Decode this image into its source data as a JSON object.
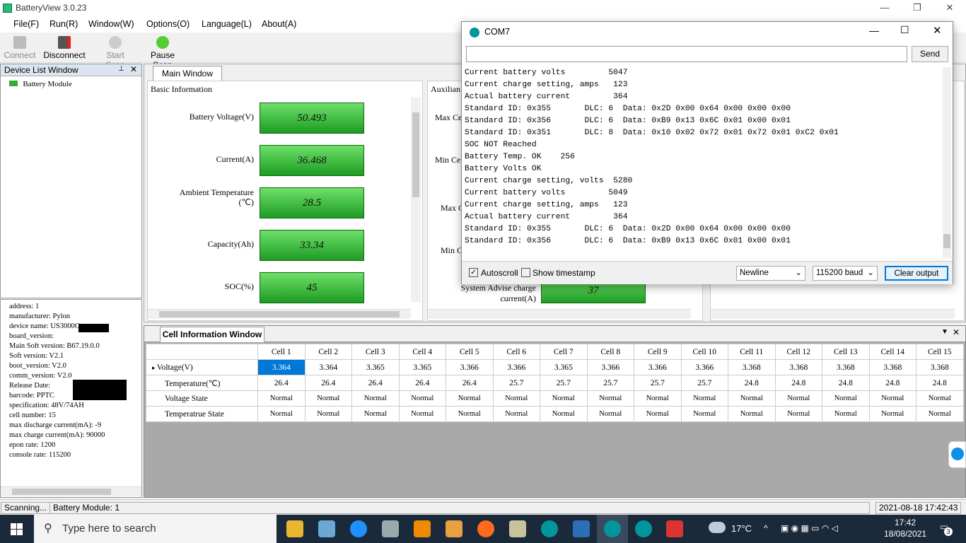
{
  "app": {
    "title": "BatteryView 3.0.23"
  },
  "window_controls": {
    "minimize": "—",
    "maximize": "❐",
    "close": "✕"
  },
  "menu": [
    "File(F)",
    "Run(R)",
    "Window(W)",
    "Options(O)",
    "Language(L)",
    "About(A)"
  ],
  "toolbar": [
    {
      "label": "Connect",
      "icon": "connect-icon"
    },
    {
      "label": "Disconnect",
      "icon": "disconnect-icon"
    },
    {
      "label": "Start Scan",
      "icon": "play-icon"
    },
    {
      "label": "Pause Scan",
      "icon": "pause-icon"
    }
  ],
  "device_list": {
    "title": "Device List Window",
    "item": "Battery Module",
    "pin": "📌",
    "close": "✕"
  },
  "properties": [
    "address: 1",
    "manufacturer: Pylon",
    "device name: US3000C",
    "board_version:",
    "Main Soft version: B67.19.0.0",
    "Soft version: V2.1",
    "boot_version: V2.0",
    "comm_version: V2.0",
    "Release Date:",
    "barcode: PPTC",
    "specification: 48V/74AH",
    "cell number: 15",
    "max discharge current(mA): -9",
    "max charge current(mA): 90000",
    "epon rate: 1200",
    "console rate: 115200"
  ],
  "main": {
    "tab": "Main Window",
    "basic_title": "Basic Information",
    "aux_title": "Auxilian",
    "values": [
      {
        "label": "Battery Voltage(V)",
        "value": "50.493"
      },
      {
        "label": "Current(A)",
        "value": "36.468"
      },
      {
        "label": "Ambient Temperature",
        "label2": "(℃)",
        "value": "28.5"
      },
      {
        "label": "Capacity(Ah)",
        "value": "33.34"
      },
      {
        "label": "SOC(%)",
        "value": "45"
      }
    ],
    "aux_labels": [
      "Max Ce",
      "Min Ce",
      "Max C",
      "Min C"
    ],
    "advise_label": "System Advise charge",
    "advise_label2": "current(A)",
    "advise_value": "37"
  },
  "cell": {
    "tab": "Cell Information Window",
    "headers": [
      "Cell 1",
      "Cell 2",
      "Cell 3",
      "Cell 4",
      "Cell 5",
      "Cell 6",
      "Cell 7",
      "Cell 8",
      "Cell 9",
      "Cell 10",
      "Cell 11",
      "Cell 12",
      "Cell 13",
      "Cell 14",
      "Cell 15"
    ],
    "rows": [
      {
        "name": "Voltage(V)",
        "values": [
          "3.364",
          "3.364",
          "3.365",
          "3.365",
          "3.366",
          "3.366",
          "3.365",
          "3.366",
          "3.366",
          "3.366",
          "3.368",
          "3.368",
          "3.368",
          "3.368",
          "3.368"
        ]
      },
      {
        "name": "Temperature(℃)",
        "values": [
          "26.4",
          "26.4",
          "26.4",
          "26.4",
          "26.4",
          "25.7",
          "25.7",
          "25.7",
          "25.7",
          "25.7",
          "24.8",
          "24.8",
          "24.8",
          "24.8",
          "24.8"
        ]
      },
      {
        "name": "Voltage State",
        "values": [
          "Normal",
          "Normal",
          "Normal",
          "Normal",
          "Normal",
          "Normal",
          "Normal",
          "Normal",
          "Normal",
          "Normal",
          "Normal",
          "Normal",
          "Normal",
          "Normal",
          "Normal"
        ]
      },
      {
        "name": "Temperatrue State",
        "values": [
          "Normal",
          "Normal",
          "Normal",
          "Normal",
          "Normal",
          "Normal",
          "Normal",
          "Normal",
          "Normal",
          "Normal",
          "Normal",
          "Normal",
          "Normal",
          "Normal",
          "Normal"
        ]
      }
    ]
  },
  "status": {
    "scan": "Scanning...",
    "module": "Battery Module: 1",
    "datetime": "2021-08-18 17:42:43"
  },
  "com": {
    "title": "COM7",
    "send": "Send",
    "input": "",
    "lines": [
      "Current battery volts         5047",
      "Current charge setting, amps   123",
      "Actual battery current         364",
      "Standard ID: 0x355       DLC: 6  Data: 0x2D 0x00 0x64 0x00 0x00 0x00",
      "Standard ID: 0x356       DLC: 6  Data: 0xB9 0x13 0x6C 0x01 0x00 0x01",
      "Standard ID: 0x351       DLC: 8  Data: 0x10 0x02 0x72 0x01 0x72 0x01 0xC2 0x01",
      "SOC NOT Reached",
      "Battery Temp. OK    256",
      "Battery Volts OK",
      "Current charge setting, volts  5280",
      "Current battery volts         5049",
      "Current charge setting, amps   123",
      "Actual battery current         364",
      "Standard ID: 0x355       DLC: 6  Data: 0x2D 0x00 0x64 0x00 0x00 0x00",
      "Standard ID: 0x356       DLC: 6  Data: 0xB9 0x13 0x6C 0x01 0x00 0x01"
    ],
    "autoscroll": "Autoscroll",
    "timestamp": "Show timestamp",
    "line_ending": "Newline",
    "baud": "115200 baud",
    "clear": "Clear output"
  },
  "taskbar": {
    "search": "Type here to search",
    "weather": "17°C",
    "time": "17:42",
    "date": "18/08/2021",
    "notifications": "3"
  }
}
